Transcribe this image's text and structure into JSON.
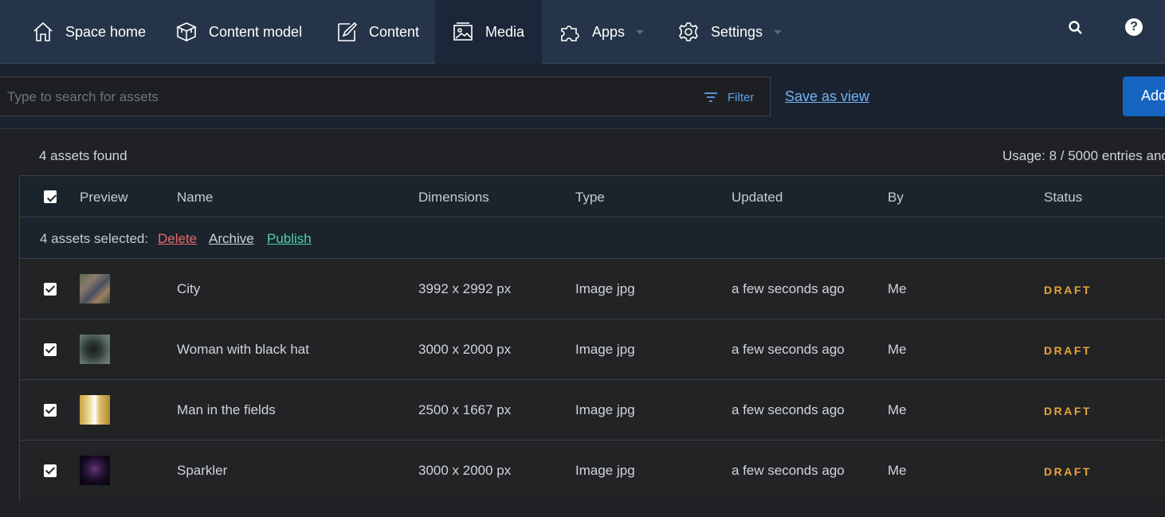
{
  "nav": {
    "items": [
      {
        "label": "Space home"
      },
      {
        "label": "Content model"
      },
      {
        "label": "Content"
      },
      {
        "label": "Media"
      },
      {
        "label": "Apps"
      },
      {
        "label": "Settings"
      }
    ],
    "active": "Media"
  },
  "toolbar": {
    "search_placeholder": "Type to search for assets",
    "filter_label": "Filter",
    "save_view_label": "Save as view",
    "add_label": "Add"
  },
  "summary": {
    "found": "4 assets found",
    "usage": "Usage: 8 / 5000 entries and"
  },
  "table": {
    "headers": [
      "Preview",
      "Name",
      "Dimensions",
      "Type",
      "Updated",
      "By",
      "Status"
    ],
    "bulk": {
      "count": "4 assets selected:",
      "delete": "Delete",
      "archive": "Archive",
      "publish": "Publish"
    },
    "rows": [
      {
        "name": "City",
        "dimensions": "3992 x 2992 px",
        "type": "Image  jpg",
        "updated": "a few seconds ago",
        "by": "Me",
        "status": "DRAFT"
      },
      {
        "name": "Woman with black hat",
        "dimensions": "3000 x 2000 px",
        "type": "Image  jpg",
        "updated": "a few seconds ago",
        "by": "Me",
        "status": "DRAFT"
      },
      {
        "name": "Man in the fields",
        "dimensions": "2500 x 1667 px",
        "type": "Image  jpg",
        "updated": "a few seconds ago",
        "by": "Me",
        "status": "DRAFT"
      },
      {
        "name": "Sparkler",
        "dimensions": "3000 x 2000 px",
        "type": "Image  jpg",
        "updated": "a few seconds ago",
        "by": "Me",
        "status": "DRAFT"
      }
    ]
  },
  "colors": {
    "nav_bg": "#253448",
    "accent_link": "#6fb4f5",
    "delete": "#e86a6a",
    "publish": "#4fd1a5",
    "draft": "#e8a33a",
    "add_button": "#1565c0"
  }
}
